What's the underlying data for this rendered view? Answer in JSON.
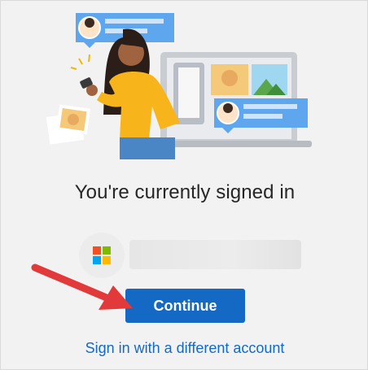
{
  "headline": "You're currently signed in",
  "account": {
    "name": ""
  },
  "buttons": {
    "continue_label": "Continue"
  },
  "links": {
    "different_account": "Sign in with a different account"
  },
  "icons": {
    "microsoft_logo": "microsoft-logo-icon",
    "annotation_arrow": "red-arrow-icon"
  },
  "colors": {
    "accent": "#1469c4",
    "arrow": "#e23a3a",
    "logo_red": "#f25022",
    "logo_green": "#7fba00",
    "logo_blue": "#00a4ef",
    "logo_yellow": "#ffb900"
  }
}
